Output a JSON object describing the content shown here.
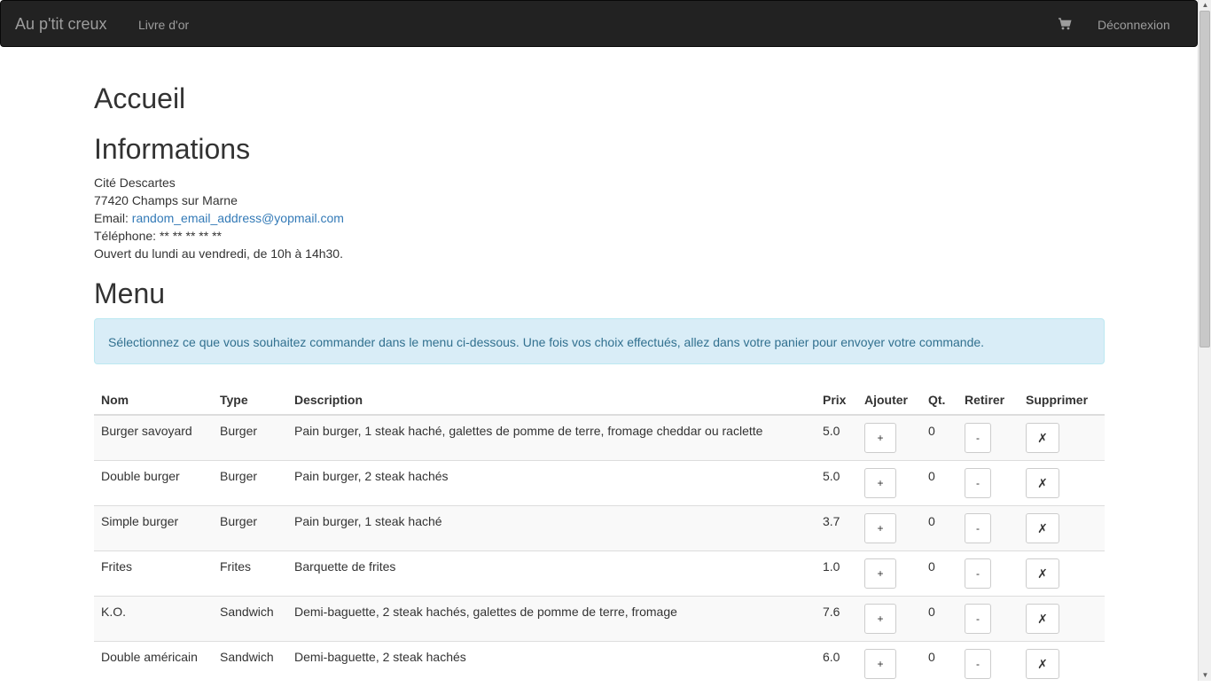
{
  "navbar": {
    "brand": "Au p'tit creux",
    "links": [
      "Livre d'or"
    ],
    "cart_icon": "shopping-cart-icon",
    "logout": "Déconnexion"
  },
  "page": {
    "title": "Accueil",
    "info_title": "Informations",
    "address_line1": "Cité Descartes",
    "address_line2": "77420 Champs sur Marne",
    "email_label": "Email: ",
    "email": "random_email_address@yopmail.com",
    "phone": "Téléphone: ** ** ** ** **",
    "hours": "Ouvert du lundi au vendredi, de 10h à 14h30.",
    "menu_title": "Menu",
    "alert": "Sélectionnez ce que vous souhaitez commander dans le menu ci-dessous. Une fois vos choix effectués, allez dans votre panier pour envoyer votre commande."
  },
  "table": {
    "headers": [
      "Nom",
      "Type",
      "Description",
      "Prix",
      "Ajouter",
      "Qt.",
      "Retirer",
      "Supprimer"
    ],
    "buttons": {
      "add": "+",
      "remove": "-",
      "delete": "✗"
    },
    "rows": [
      {
        "nom": "Burger savoyard",
        "type": "Burger",
        "description": "Pain burger, 1 steak haché, galettes de pomme de terre, fromage cheddar ou raclette",
        "prix": "5.0",
        "qt": "0"
      },
      {
        "nom": "Double burger",
        "type": "Burger",
        "description": "Pain burger, 2 steak hachés",
        "prix": "5.0",
        "qt": "0"
      },
      {
        "nom": "Simple burger",
        "type": "Burger",
        "description": "Pain burger, 1 steak haché",
        "prix": "3.7",
        "qt": "0"
      },
      {
        "nom": "Frites",
        "type": "Frites",
        "description": "Barquette de frites",
        "prix": "1.0",
        "qt": "0"
      },
      {
        "nom": "K.O.",
        "type": "Sandwich",
        "description": "Demi-baguette, 2 steak hachés, galettes de pomme de terre, fromage",
        "prix": "7.6",
        "qt": "0"
      },
      {
        "nom": "Double américain",
        "type": "Sandwich",
        "description": "Demi-baguette, 2 steak hachés",
        "prix": "6.0",
        "qt": "0"
      }
    ]
  },
  "scrollbar": {
    "up": "▲",
    "down": "▼"
  }
}
